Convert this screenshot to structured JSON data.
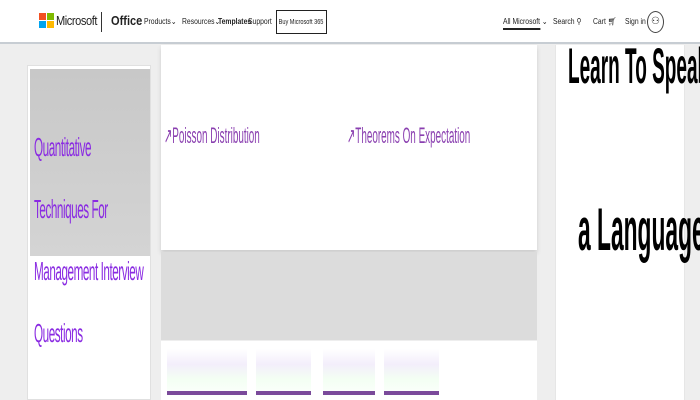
{
  "header": {
    "brand": "Microsoft",
    "product": "Office",
    "nav": [
      "Products",
      "Resources",
      "Templates",
      "Support"
    ],
    "buy_label": "Buy Microsoft 365",
    "all_microsoft": "All Microsoft",
    "search": "Search",
    "cart": "Cart",
    "sign_in": "Sign in"
  },
  "sidebar": {
    "title": "Quantitative Techniques For Management Interview Questions"
  },
  "main": {
    "links": [
      "Poisson Distribution",
      "Theorems On Expectation"
    ]
  },
  "ad": {
    "line1": "Learn To Speak",
    "line2": "a Language"
  }
}
